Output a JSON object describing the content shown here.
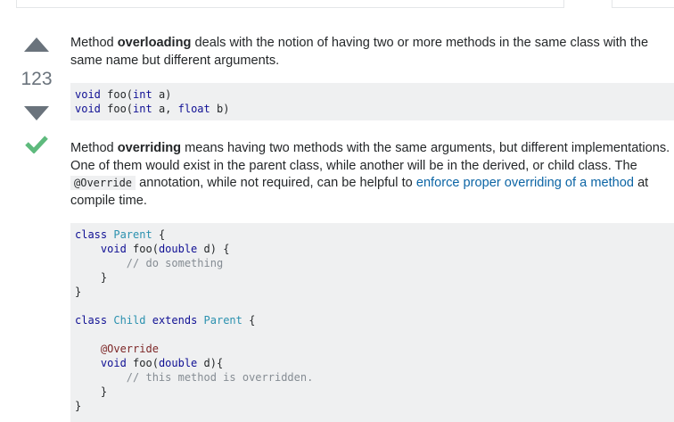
{
  "vote": {
    "count": "123",
    "accepted_color": "#5eba7d",
    "arrow_color": "#6a737c"
  },
  "paragraph1": {
    "before": "Method ",
    "bold": "overloading",
    "after": " deals with the notion of having two or more methods in the same class with the same name but different arguments."
  },
  "code1": {
    "line1_kw": "void",
    "line1_rest": " foo(",
    "line1_kw2": "int",
    "line1_end": " a)",
    "line2_kw": "void",
    "line2_rest": " foo(",
    "line2_kw2": "int",
    "line2_mid": " a, ",
    "line2_kw3": "float",
    "line2_end": " b)"
  },
  "paragraph2": {
    "before": "Method ",
    "bold": "overriding",
    "text1": " means having two methods with the same arguments, but different implementations. One of them would exist in the parent class, while another will be in the derived, or child class. The ",
    "code": "@Override",
    "text2": " annotation, while not required, can be helpful to ",
    "link": "enforce proper overriding of a method",
    "text3": " at compile time."
  },
  "code2": {
    "class_kw": "class",
    "parent": "Parent",
    "open": " {",
    "void_kw": "void",
    "foo": " foo(",
    "double_kw": "double",
    "param": " d) {",
    "comment1": "// do something",
    "child": "Child",
    "extends_kw": "extends",
    "annotation": "@Override",
    "param2": " d){",
    "comment2": "// this method is overridden.",
    "close": "}"
  }
}
